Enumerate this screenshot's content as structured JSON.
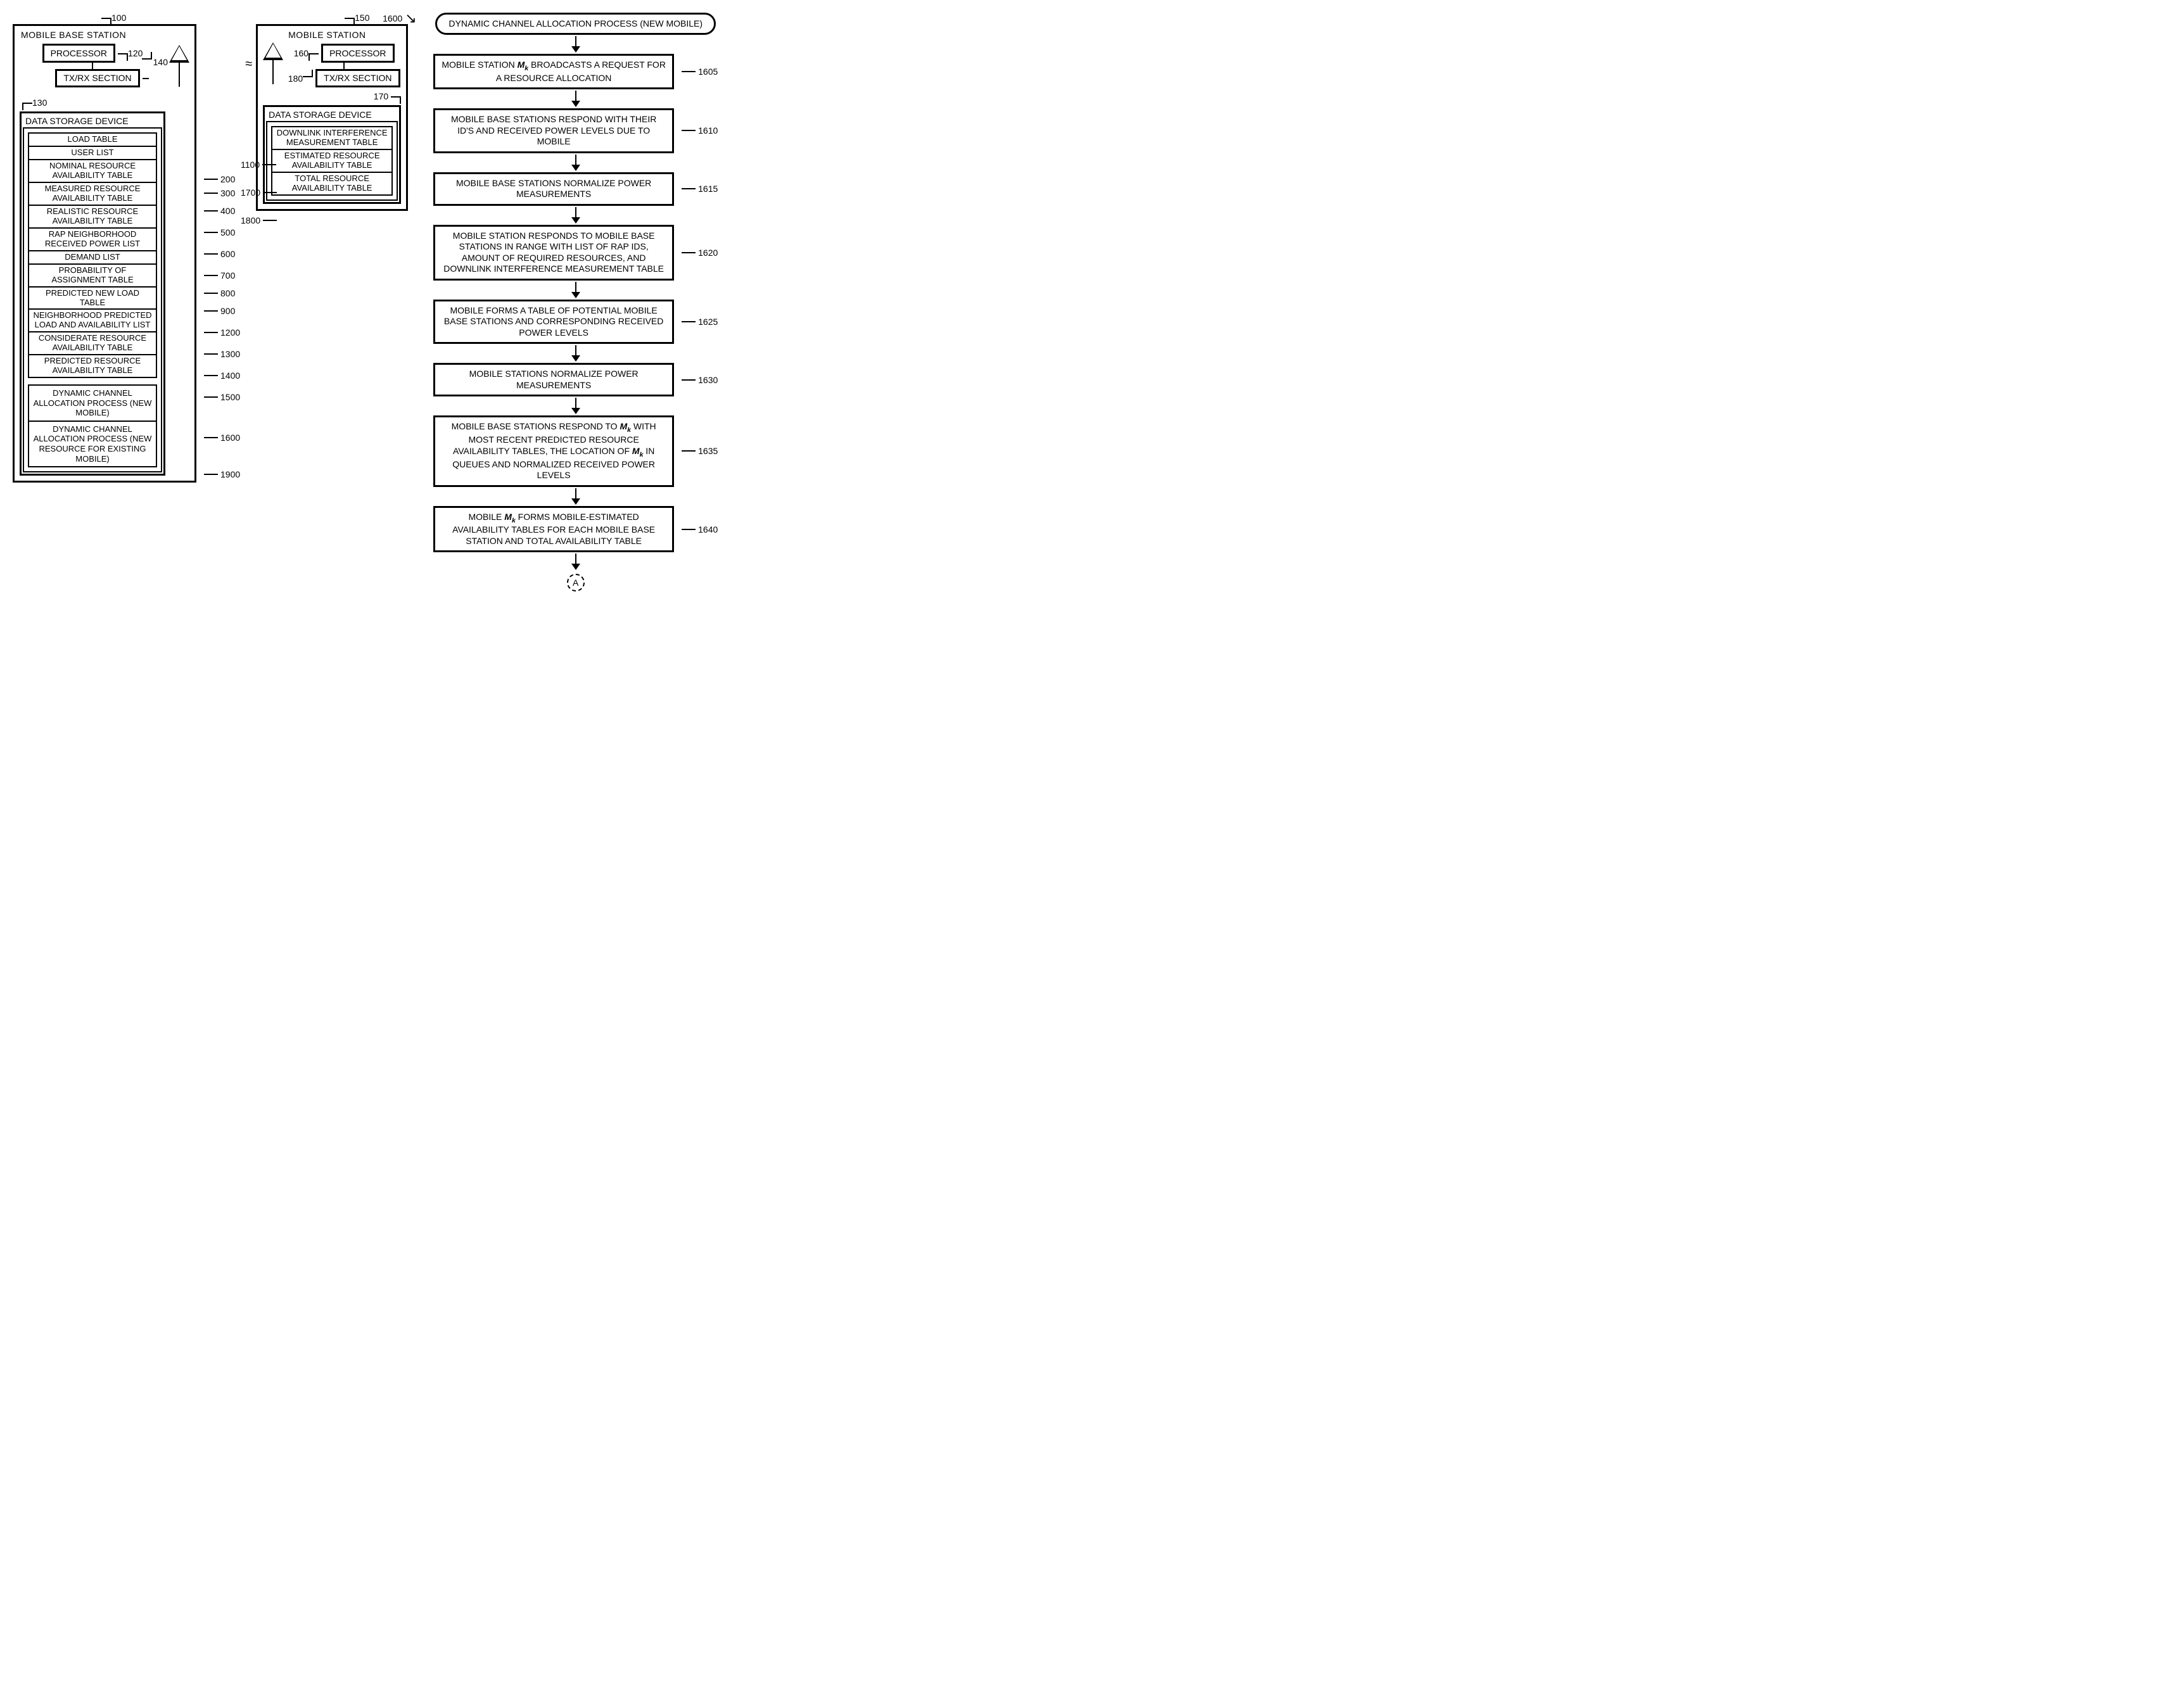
{
  "base_station": {
    "ref": "100",
    "title": "MOBILE BASE STATION",
    "processor": {
      "ref": "120",
      "label": "PROCESSOR"
    },
    "txrx": {
      "ref": "140",
      "label": "TX/RX SECTION"
    },
    "dsd": {
      "ref": "130",
      "title": "DATA STORAGE DEVICE",
      "tables": [
        {
          "ref": "200",
          "label": "LOAD TABLE"
        },
        {
          "ref": "300",
          "label": "USER LIST"
        },
        {
          "ref": "400",
          "label": "NOMINAL RESOURCE AVAILABILITY TABLE"
        },
        {
          "ref": "500",
          "label": "MEASURED RESOURCE AVAILABILITY TABLE"
        },
        {
          "ref": "600",
          "label": "REALISTIC RESOURCE AVAILABILITY TABLE"
        },
        {
          "ref": "700",
          "label": "RAP NEIGHBORHOOD RECEIVED POWER LIST"
        },
        {
          "ref": "800",
          "label": "DEMAND LIST"
        },
        {
          "ref": "900",
          "label": "PROBABILITY OF ASSIGNMENT TABLE"
        },
        {
          "ref": "1200",
          "label": "PREDICTED NEW LOAD TABLE"
        },
        {
          "ref": "1300",
          "label": "NEIGHBORHOOD PREDICTED LOAD AND AVAILABILITY LIST"
        },
        {
          "ref": "1400",
          "label": "CONSIDERATE RESOURCE AVAILABILITY TABLE"
        },
        {
          "ref": "1500",
          "label": "PREDICTED RESOURCE AVAILABILITY TABLE"
        }
      ],
      "processes": [
        {
          "ref": "1600",
          "label": "DYNAMIC CHANNEL ALLOCATION PROCESS (NEW MOBILE)"
        },
        {
          "ref": "1900",
          "label": "DYNAMIC CHANNEL ALLOCATION PROCESS (NEW RESOURCE FOR EXISTING MOBILE)"
        }
      ]
    }
  },
  "mobile_station": {
    "ref": "150",
    "title": "MOBILE STATION",
    "processor": {
      "ref": "160",
      "label": "PROCESSOR"
    },
    "txrx": {
      "ref": "180",
      "label": "TX/RX SECTION"
    },
    "dsd": {
      "ref": "170",
      "title": "DATA STORAGE DEVICE",
      "tables": [
        {
          "ref": "1100",
          "label": "DOWNLINK INTERFERENCE MEASUREMENT TABLE"
        },
        {
          "ref": "1700",
          "label": "ESTIMATED RESOURCE AVAILABILITY TABLE"
        },
        {
          "ref": "1800",
          "label": "TOTAL RESOURCE AVAILABILITY TABLE"
        }
      ]
    }
  },
  "flowchart": {
    "ref": "1600",
    "start": "DYNAMIC CHANNEL ALLOCATION PROCESS (NEW MOBILE)",
    "offpage": "A",
    "steps": [
      {
        "ref": "1605",
        "label": "MOBILE STATION Mₖ BROADCASTS A REQUEST FOR A RESOURCE ALLOCATION"
      },
      {
        "ref": "1610",
        "label": "MOBILE BASE STATIONS RESPOND WITH THEIR ID'S AND RECEIVED POWER LEVELS DUE TO MOBILE"
      },
      {
        "ref": "1615",
        "label": "MOBILE BASE STATIONS NORMALIZE POWER MEASUREMENTS"
      },
      {
        "ref": "1620",
        "label": "MOBILE STATION RESPONDS TO MOBILE BASE STATIONS IN RANGE WITH LIST OF RAP IDS, AMOUNT OF REQUIRED RESOURCES, AND DOWNLINK INTERFERENCE MEASUREMENT TABLE"
      },
      {
        "ref": "1625",
        "label": "MOBILE FORMS A TABLE OF POTENTIAL MOBILE BASE STATIONS AND CORRESPONDING RECEIVED POWER LEVELS"
      },
      {
        "ref": "1630",
        "label": "MOBILE STATIONS NORMALIZE POWER MEASUREMENTS"
      },
      {
        "ref": "1635",
        "label": "MOBILE BASE STATIONS RESPOND TO Mₖ WITH MOST RECENT PREDICTED RESOURCE AVAILABILITY TABLES, THE LOCATION OF Mₖ IN QUEUES AND NORMALIZED RECEIVED POWER LEVELS"
      },
      {
        "ref": "1640",
        "label": "MOBILE Mₖ FORMS MOBILE-ESTIMATED AVAILABILITY TABLES FOR EACH MOBILE BASE STATION AND TOTAL AVAILABILITY TABLE"
      }
    ]
  }
}
